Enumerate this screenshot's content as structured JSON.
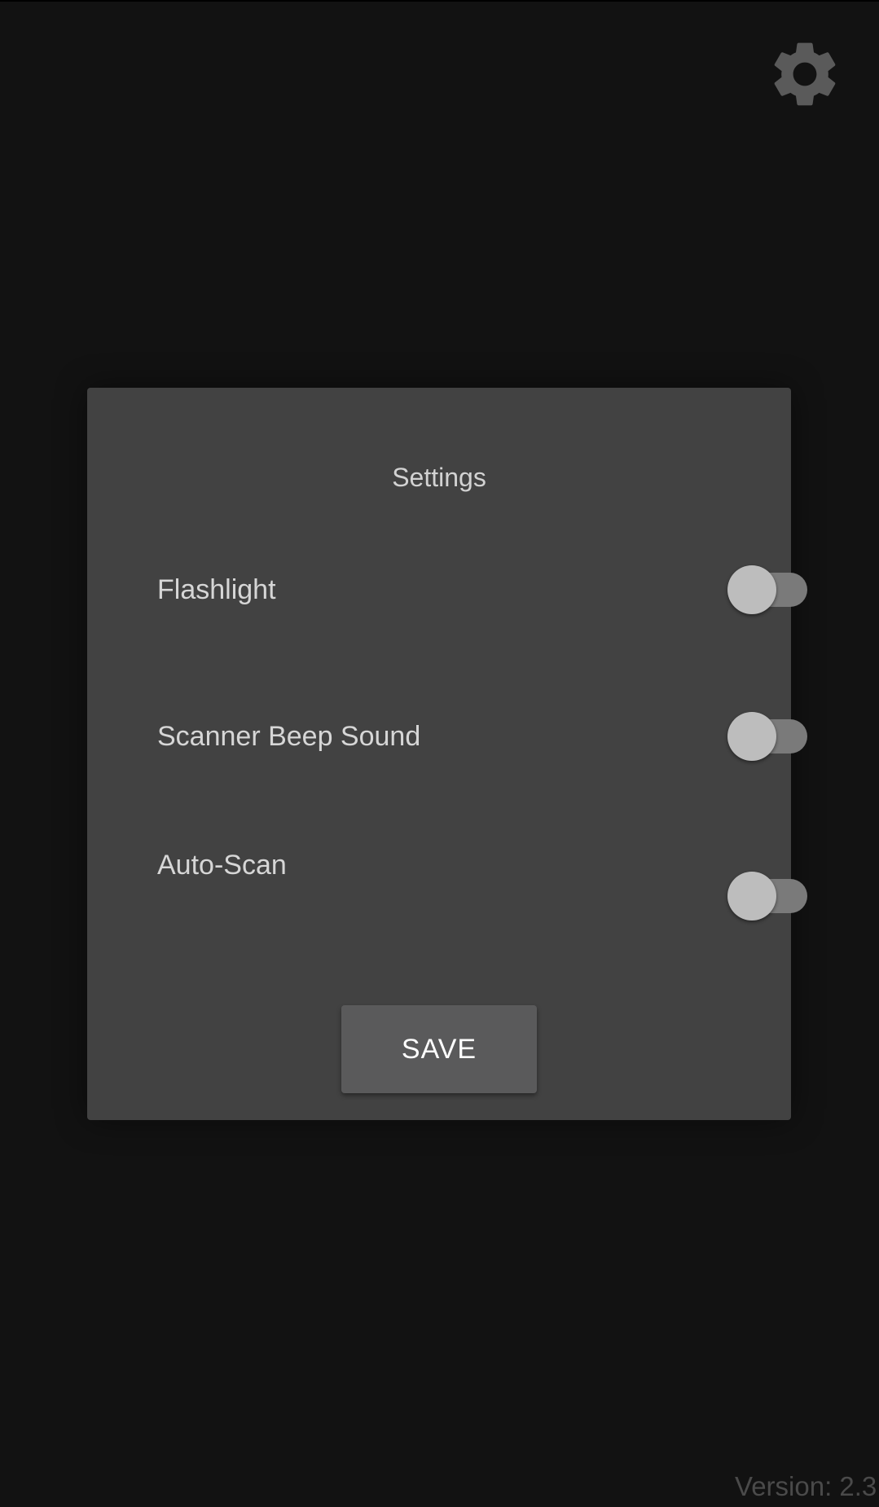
{
  "header": {
    "settings_icon": "gear-icon"
  },
  "dialog": {
    "title": "Settings",
    "options": [
      {
        "label": "Flashlight",
        "enabled": false
      },
      {
        "label": "Scanner Beep Sound",
        "enabled": false
      },
      {
        "label": "Auto-Scan",
        "enabled": false
      }
    ],
    "save_label": "SAVE"
  },
  "footer": {
    "version": "Version: 2.3"
  },
  "colors": {
    "background": "#121212",
    "dialog": "#424242",
    "button": "#5a5a5b",
    "switch_thumb": "#bdbdbd",
    "switch_track": "#7a7a7a",
    "gear": "#5a5a5a"
  }
}
